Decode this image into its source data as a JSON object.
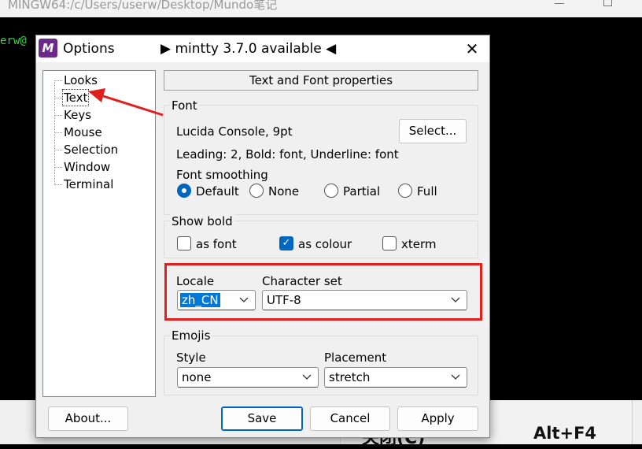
{
  "terminal": {
    "title": "MINGW64:/c/Users/userw/Desktop/Mundo笔记",
    "prompt": "erw@",
    "context_menu": {
      "close_label": "关闭(C)",
      "close_shortcut": "Alt+F4"
    }
  },
  "dialog": {
    "app_icon": "M",
    "title": "Options",
    "update_notice": "▶ mintty 3.7.0 available ◀",
    "close_icon": "✕",
    "tree": {
      "items": [
        {
          "label": "Looks",
          "selected": false
        },
        {
          "label": "Text",
          "selected": true
        },
        {
          "label": "Keys",
          "selected": false
        },
        {
          "label": "Mouse",
          "selected": false
        },
        {
          "label": "Selection",
          "selected": false
        },
        {
          "label": "Window",
          "selected": false
        },
        {
          "label": "Terminal",
          "selected": false
        }
      ]
    },
    "header": "Text and Font properties",
    "font": {
      "group_title": "Font",
      "font_name": "Lucida Console, 9pt",
      "select_button": "Select...",
      "details": "Leading: 2, Bold: font, Underline: font",
      "smoothing_label": "Font smoothing",
      "smoothing_options": [
        {
          "label": "Default",
          "checked": true
        },
        {
          "label": "None",
          "checked": false
        },
        {
          "label": "Partial",
          "checked": false
        },
        {
          "label": "Full",
          "checked": false
        }
      ]
    },
    "show_bold": {
      "group_title": "Show bold",
      "options": [
        {
          "label": "as font",
          "checked": false
        },
        {
          "label": "as colour",
          "checked": true
        },
        {
          "label": "xterm",
          "checked": false
        }
      ]
    },
    "locale": {
      "locale_label": "Locale",
      "locale_value": "zh_CN",
      "charset_label": "Character set",
      "charset_value": "UTF-8"
    },
    "emojis": {
      "group_title": "Emojis",
      "style_label": "Style",
      "style_value": "none",
      "placement_label": "Placement",
      "placement_value": "stretch"
    },
    "buttons": {
      "about": "About...",
      "save": "Save",
      "cancel": "Cancel",
      "apply": "Apply"
    }
  },
  "colors": {
    "annotation_red": "#e0201e",
    "accent_blue": "#0067c0",
    "terminal_green": "#3fd14a",
    "app_icon_purple": "#6b2a8a"
  }
}
